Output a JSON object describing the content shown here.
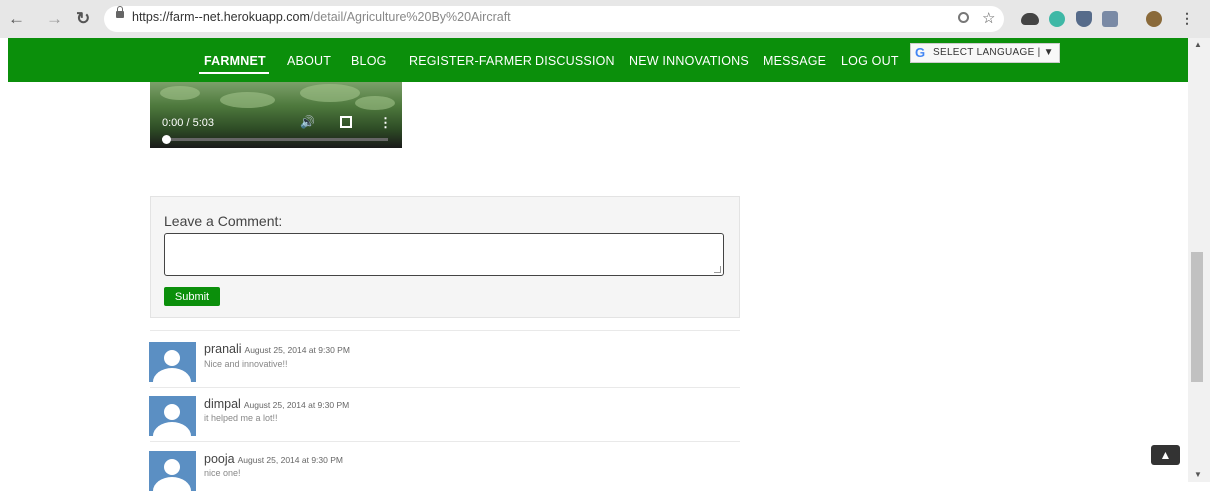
{
  "browser": {
    "url_host": "https://farm--net.herokuapp.com",
    "url_path": "/detail/Agriculture%20By%20Aircraft"
  },
  "nav": {
    "items": [
      "FARMNET",
      "ABOUT",
      "BLOG",
      "REGISTER-FARMER",
      "DISCUSSION",
      "NEW INNOVATIONS",
      "MESSAGE",
      "LOG OUT"
    ],
    "language_label": "SELECT LANGUAGE | ▼",
    "language_logo": "G"
  },
  "video": {
    "time": "0:00 / 5:03",
    "progress": 0
  },
  "comment_form": {
    "label": "Leave a Comment:",
    "textarea_value": "",
    "submit_label": "Submit"
  },
  "comments": [
    {
      "name": "pranali",
      "date": "August 25, 2014 at 9:30 PM",
      "text": "Nice and innovative!!"
    },
    {
      "name": "dimpal",
      "date": "August 25, 2014 at 9:30 PM",
      "text": "it helped me a lot!!"
    },
    {
      "name": "pooja",
      "date": "August 25, 2014 at 9:30 PM",
      "text": "nice one!"
    }
  ],
  "colors": {
    "brand_green": "#0b8f0b",
    "avatar_blue": "#5b8fc3"
  },
  "icons": [
    "back-arrow-icon",
    "forward-arrow-icon",
    "reload-icon",
    "lock-icon",
    "search-icon",
    "star-icon",
    "extension-icons",
    "menu-icon",
    "scroll-top-icon"
  ]
}
